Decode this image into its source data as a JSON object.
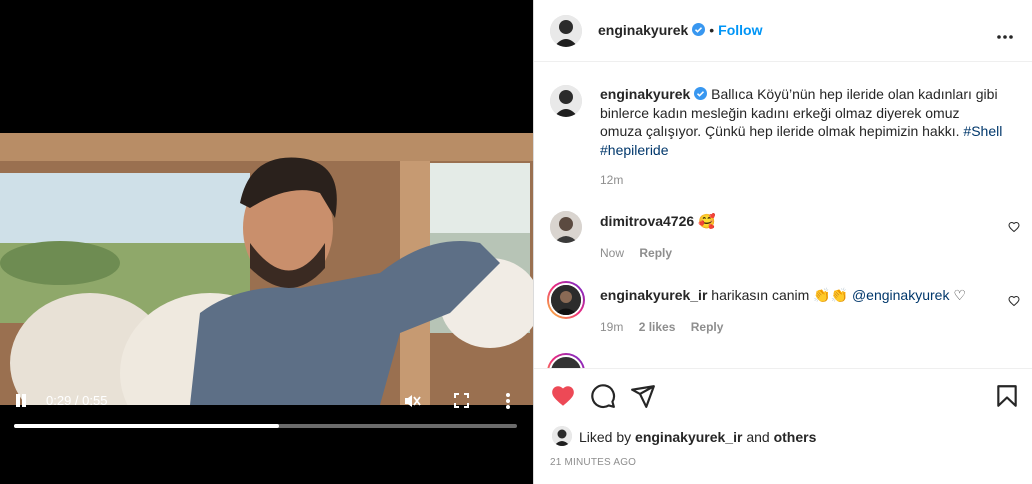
{
  "video": {
    "time": "0:29 / 0:55",
    "progress": 0.527
  },
  "post": {
    "author": "enginakyurek",
    "follow_label": "Follow",
    "separator": "•",
    "caption": {
      "username": "enginakyurek",
      "text": "Ballıca Köyü’nün hep ileride olan kadınları gibi binlerce kadın mesleğin kadını erkeği olmaz diyerek omuz omuza çalışıyor. Çünkü hep ileride olmak hepimizin hakkı.",
      "hashtag1": "#Shell",
      "hashtag2": "#hepileride",
      "age": "12m"
    },
    "comments": [
      {
        "username": "dimitrova4726",
        "text": "🥰",
        "age": "Now",
        "reply": "Reply"
      },
      {
        "username": "enginakyurek_ir",
        "text": "harikasın canim 👏👏",
        "mention": "@enginakyurek",
        "suffix": "♡",
        "age": "19m",
        "likes": "2 likes",
        "reply": "Reply"
      }
    ],
    "liked_by_prefix": "Liked by",
    "liked_by_user": "enginakyurek_ir",
    "liked_by_and": "and",
    "liked_by_others": "others",
    "timestamp": "21 MINUTES AGO"
  },
  "colors": {
    "like_red": "#ed4956",
    "link_blue": "#0095f6",
    "hashtag": "#00376b",
    "verified": "#3897f0"
  },
  "icons": [
    "pause-icon",
    "mute-icon",
    "fullscreen-icon",
    "more-vertical-icon",
    "verified-icon",
    "more-horizontal-icon",
    "heart-icon",
    "comment-icon",
    "share-icon",
    "bookmark-icon"
  ]
}
